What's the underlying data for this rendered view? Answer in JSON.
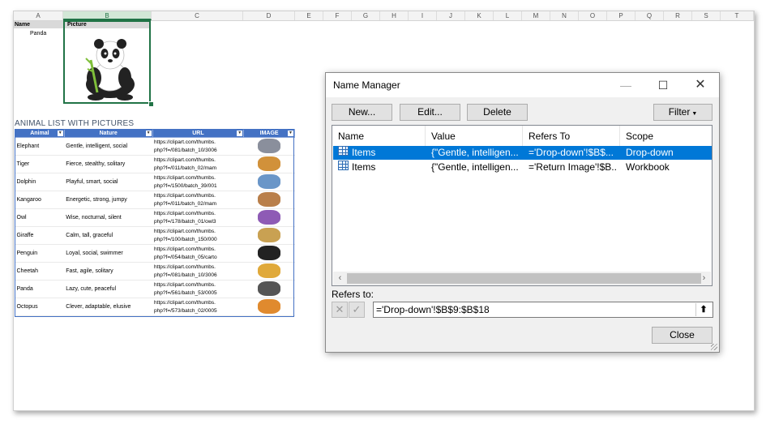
{
  "sheet": {
    "columns": [
      "A",
      "B",
      "C",
      "D",
      "E",
      "F",
      "G",
      "H",
      "I",
      "J",
      "K",
      "L",
      "M",
      "N",
      "O",
      "P",
      "Q",
      "R",
      "S",
      "T"
    ],
    "top_table": {
      "header_name": "Name",
      "header_picture": "Picture",
      "name_value": "Panda"
    },
    "list_title": "ANIMAL LIST WITH PICTURES",
    "table_headers": [
      "Animal",
      "Nature",
      "URL",
      "IMAGE"
    ],
    "rows": [
      {
        "animal": "Elephant",
        "nature": "Gentle, intelligent, social",
        "url1": "https://clipart.com/thumbs.",
        "url2": "php?f=/081/batch_10/3006",
        "color": "#8a8f9c"
      },
      {
        "animal": "Tiger",
        "nature": "Fierce, stealthy, solitary",
        "url1": "https://clipart.com/thumbs.",
        "url2": "php?f=/011/batch_02/mam",
        "color": "#d1913a"
      },
      {
        "animal": "Dolphin",
        "nature": "Playful, smart, social",
        "url1": "https://clipart.com/thumbs.",
        "url2": "php?f=/1500/batch_39/001",
        "color": "#6a96c8"
      },
      {
        "animal": "Kangaroo",
        "nature": "Energetic, strong, jumpy",
        "url1": "https://clipart.com/thumbs.",
        "url2": "php?f=/011/batch_02/mam",
        "color": "#b97f4a"
      },
      {
        "animal": "Owl",
        "nature": "Wise, nocturnal, silent",
        "url1": "https://clipart.com/thumbs.",
        "url2": "php?f=/178/batch_01/owl3",
        "color": "#8e5bb5"
      },
      {
        "animal": "Giraffe",
        "nature": "Calm, tall, graceful",
        "url1": "https://clipart.com/thumbs.",
        "url2": "php?f=/100/batch_150/000",
        "color": "#c9a152"
      },
      {
        "animal": "Penguin",
        "nature": "Loyal, social, swimmer",
        "url1": "https://clipart.com/thumbs.",
        "url2": "php?f=/054/batch_05/carto",
        "color": "#222222"
      },
      {
        "animal": "Cheetah",
        "nature": "Fast, agile, solitary",
        "url1": "https://clipart.com/thumbs.",
        "url2": "php?f=/081/batch_10/3006",
        "color": "#e0a93a"
      },
      {
        "animal": "Panda",
        "nature": "Lazy, cute, peaceful",
        "url1": "https://clipart.com/thumbs.",
        "url2": "php?f=/561/batch_53/0005",
        "color": "#555555"
      },
      {
        "animal": "Octopus",
        "nature": "Clever, adaptable, elusive",
        "url1": "https://clipart.com/thumbs.",
        "url2": "php?f=/573/batch_02/0005",
        "color": "#e08a2e"
      }
    ]
  },
  "dialog": {
    "title": "Name Manager",
    "buttons": {
      "new": "New...",
      "edit": "Edit...",
      "delete": "Delete",
      "filter": "Filter",
      "close": "Close"
    },
    "columns": [
      "Name",
      "Value",
      "Refers To",
      "Scope"
    ],
    "items": [
      {
        "name": "Items",
        "value": "{\"Gentle, intelligen...",
        "refers": "='Drop-down'!$B$...",
        "scope": "Drop-down"
      },
      {
        "name": "Items",
        "value": "{\"Gentle, intelligen...",
        "refers": "='Return Image'!$B...",
        "scope": "Workbook"
      }
    ],
    "refers_label": "Refers to:",
    "refers_value": "='Drop-down'!$B$9:$B$18"
  }
}
